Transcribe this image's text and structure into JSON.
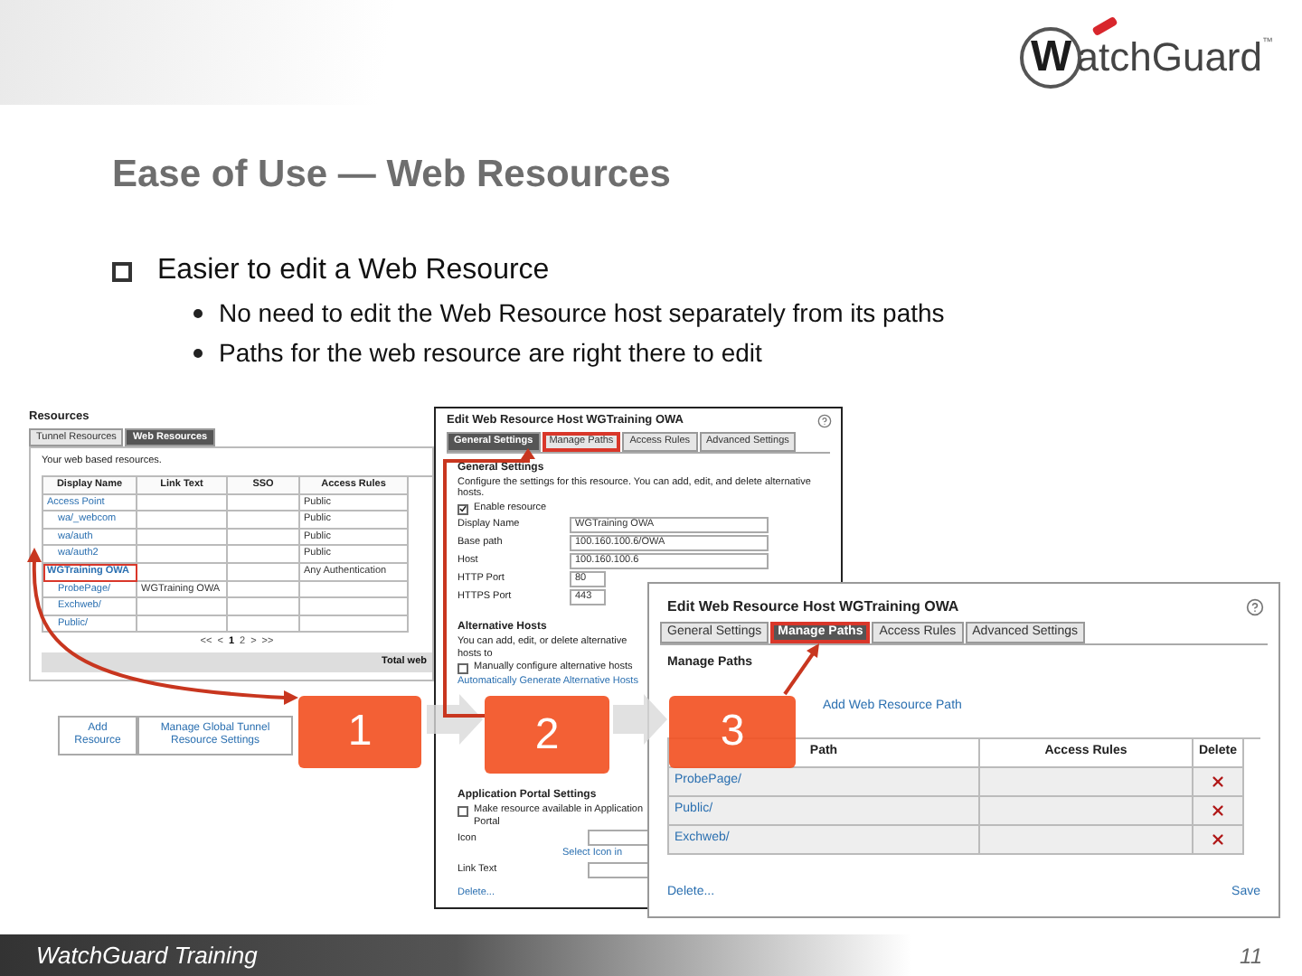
{
  "logo": {
    "initial": "W",
    "name": "atchGuard",
    "trademark": "™"
  },
  "title": "Ease of Use — Web Resources",
  "bullets": [
    {
      "text": "Easier to edit a Web Resource",
      "children": [
        {
          "text": "No need to edit the Web Resource host separately from its paths"
        },
        {
          "text": "Paths for the web resource are right there to edit"
        }
      ]
    }
  ],
  "resources_screen": {
    "title": "Resources",
    "tabs": [
      {
        "label": "Tunnel Resources",
        "selected": false
      },
      {
        "label": "Web Resources",
        "selected": true
      }
    ],
    "intro": "Your web based resources.",
    "columns": [
      "Display Name",
      "Link Text",
      "SSO",
      "Access Rules"
    ],
    "rows": [
      {
        "name": "Access Point",
        "access": "Public",
        "highlighted": false,
        "children": [
          {
            "name": "wa/_webcom",
            "access": "Public",
            "highlighted": false
          },
          {
            "name": "wa/auth",
            "access": "Public",
            "highlighted": false
          },
          {
            "name": "wa/auth2",
            "access": "Public",
            "highlighted": false
          }
        ]
      },
      {
        "name": "WGTraining OWA",
        "access": "Any Authentication",
        "highlighted": true,
        "children": [
          {
            "name": "ProbePage/",
            "link_text": "WGTraining OWA",
            "highlighted": false
          },
          {
            "name": "Exchweb/",
            "highlighted": false
          },
          {
            "name": "Public/",
            "highlighted": false
          }
        ]
      }
    ],
    "pager": [
      {
        "label": "<<",
        "selected": false
      },
      {
        "label": "<",
        "selected": false
      },
      {
        "label": "1",
        "selected": true
      },
      {
        "label": "2",
        "selected": false
      },
      {
        "label": ">",
        "selected": false
      },
      {
        "label": ">>",
        "selected": false
      }
    ],
    "total": "Total web",
    "buttons": [
      "Add Resource",
      "Manage Global Tunnel Resource Settings"
    ]
  },
  "general_screen": {
    "title": "Edit Web Resource Host WGTraining OWA",
    "tabs": [
      {
        "label": "General Settings",
        "selected": true,
        "highlighted": false
      },
      {
        "label": "Manage Paths",
        "selected": false,
        "highlighted": true
      },
      {
        "label": "Access Rules",
        "selected": false,
        "highlighted": false
      },
      {
        "label": "Advanced Settings",
        "selected": false,
        "highlighted": false
      }
    ],
    "section": "General Settings",
    "description": "Configure the settings for this resource. You can add, edit, and delete alternative hosts.",
    "enable": {
      "label": "Enable resource",
      "checked": true
    },
    "fields": [
      {
        "label": "Display Name",
        "value": "WGTraining OWA"
      },
      {
        "label": "Base path",
        "value": "100.160.100.6/OWA"
      },
      {
        "label": "Host",
        "value": "100.160.100.6"
      },
      {
        "label": "HTTP Port",
        "value": "80"
      },
      {
        "label": "HTTPS Port",
        "value": "443"
      }
    ],
    "alt_section": "Alternative Hosts",
    "alt_description": "You can add, edit, or delete alternative hosts to",
    "manual": {
      "label": "Manually configure alternative hosts",
      "checked": false
    },
    "generate_link": "Automatically Generate Alternative Hosts",
    "portal_section": "Application Portal Settings",
    "portal": {
      "label": "Make resource available in Application Portal",
      "checked": false
    },
    "icon_label": "Icon",
    "icon_link": "Select Icon in",
    "link_text_label": "Link Text",
    "delete": "Delete..."
  },
  "paths_screen": {
    "title": "Edit Web Resource Host WGTraining OWA",
    "tabs": [
      {
        "label": "General Settings",
        "selected": false,
        "highlighted": false
      },
      {
        "label": "Manage Paths",
        "selected": true,
        "highlighted": true
      },
      {
        "label": "Access Rules",
        "selected": false,
        "highlighted": false
      },
      {
        "label": "Advanced Settings",
        "selected": false,
        "highlighted": false
      }
    ],
    "section": "Manage Paths",
    "add_link": "Add Web Resource Path",
    "columns": [
      "Path",
      "Access Rules",
      "Delete"
    ],
    "rows": [
      {
        "path": "ProbePage/"
      },
      {
        "path": "Public/"
      },
      {
        "path": "Exchweb/"
      }
    ],
    "delete": "Delete...",
    "save": "Save"
  },
  "steps": [
    "1",
    "2",
    "3"
  ],
  "footer": {
    "label": "WatchGuard Training",
    "page": "11"
  }
}
